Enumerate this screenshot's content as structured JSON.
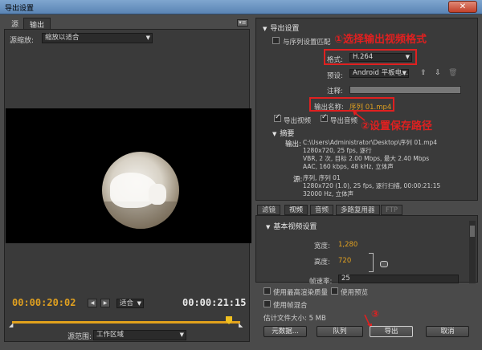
{
  "window": {
    "title": "导出设置",
    "close": "✕"
  },
  "left": {
    "tabs": [
      "源",
      "输出"
    ],
    "scale_label": "源缩放:",
    "scale_value": "缩放以适合",
    "timecode_in": "00:00:20:02",
    "timecode_out": "00:00:21:15",
    "fit_value": "适合",
    "range_label": "源范围:",
    "range_value": "工作区域"
  },
  "export": {
    "header": "导出设置",
    "match_seq_label": "与序列设置匹配",
    "format_label": "格式:",
    "format_value": "H.264",
    "preset_label": "预设:",
    "preset_value": "Android 平板电...",
    "notes_label": "注释:",
    "output_name_label": "输出名称:",
    "output_name_value": "序列 01.mp4",
    "export_video": "导出视频",
    "export_audio": "导出音频",
    "summary_header": "摘要",
    "output_label": "输出:",
    "output_lines": [
      "C:\\Users\\Administrator\\Desktop\\序列 01.mp4",
      "1280x720, 25 fps, 逐行",
      "VBR, 2 次, 目标 2.00 Mbps, 最大 2.40 Mbps",
      "AAC, 160 kbps, 48 kHz, 立体声"
    ],
    "source_label": "源:",
    "source_lines": [
      "序列, 序列 01",
      "1280x720 (1.0), 25 fps, 逐行扫描, 00:00:21:15",
      "32000 Hz, 立体声"
    ]
  },
  "annotations": {
    "a1": "①选择输出视频格式",
    "a2": "②设置保存路径",
    "a3": "③"
  },
  "tabs2": [
    "滤镜",
    "视频",
    "音频",
    "多路复用器",
    "FTP"
  ],
  "video": {
    "header": "基本视频设置",
    "width_label": "宽度:",
    "width_value": "1,280",
    "height_label": "高度:",
    "height_value": "720",
    "fps_label": "帧速率:",
    "fps_value": "25"
  },
  "options": {
    "max_render": "使用最高渲染质量",
    "use_preview": "使用预览",
    "use_blend": "使用帧混合",
    "filesize": "估计文件大小: 5 MB"
  },
  "buttons": {
    "metadata": "元数据...",
    "queue": "队列",
    "export": "导出",
    "cancel": "取消"
  },
  "colors": {
    "accent": "#e0a020",
    "annotation": "#e02020"
  }
}
